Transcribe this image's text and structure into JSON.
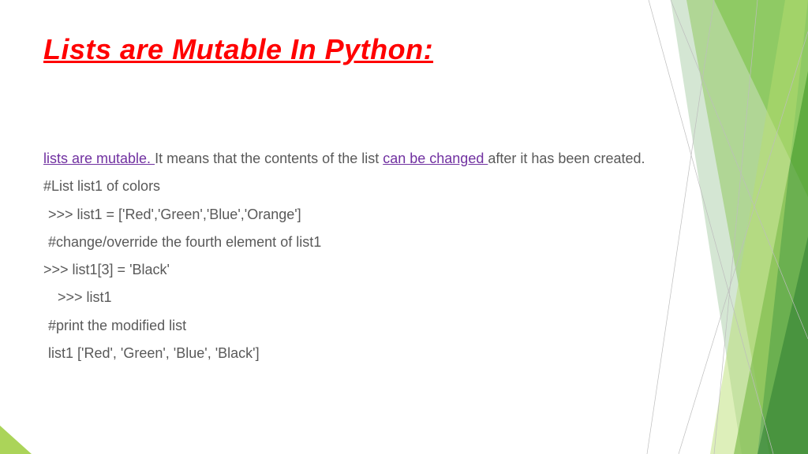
{
  "title": "Lists are Mutable In Python:",
  "intro": {
    "link1": "lists are mutable. ",
    "mid1": "It means that the contents of the list ",
    "link2": "can be changed ",
    "mid2": "after it has been created."
  },
  "lines": {
    "c1": "#List list1 of colors",
    "c2": ">>> list1 = ['Red','Green','Blue','Orange']",
    "c3": "#change/override the fourth element of list1",
    "c4": ">>> list1[3] = 'Black'",
    "c5": ">>> list1",
    "c6": "#print the modified list",
    "c7": "list1 ['Red', 'Green', 'Blue', 'Black']"
  }
}
